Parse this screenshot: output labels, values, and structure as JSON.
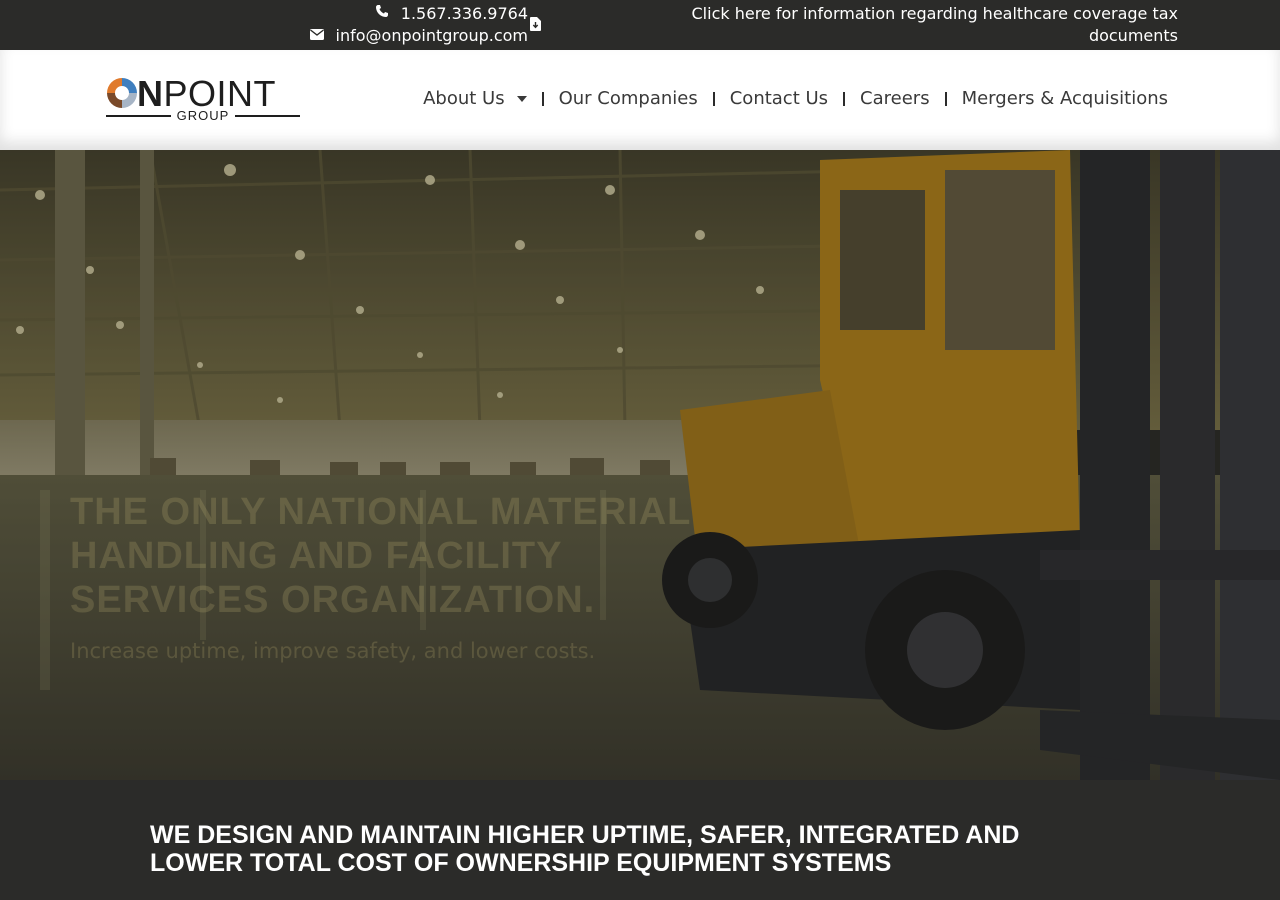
{
  "topbar": {
    "phone": "1.567.336.9764",
    "email": "info@onpointgroup.com",
    "phone_icon": "phone-icon",
    "email_icon": "envelope-icon",
    "document_icon": "file-download-icon",
    "notice": "Click here for information regarding healthcare coverage tax documents"
  },
  "logo": {
    "word_bold": "N",
    "word_light": "POINT",
    "sub": "GROUP",
    "colors": [
      "#e07a2c",
      "#3f7fbf",
      "#a7b5c6",
      "#7a4a2a"
    ]
  },
  "nav": {
    "items": [
      {
        "label": "About Us",
        "has_dropdown": true
      },
      {
        "label": "Our Companies"
      },
      {
        "label": "Contact Us"
      },
      {
        "label": "Careers"
      },
      {
        "label": "Mergers & Acquisitions"
      }
    ]
  },
  "hero": {
    "title": "The only national material handling and facility services organization.",
    "subtitle": "Increase uptime, improve safety, and lower costs."
  },
  "bottom": {
    "title": "We design and maintain higher uptime, safer, integrated and lower total cost of ownership equipment systems"
  },
  "colors": {
    "dark_bar": "#2b2b29",
    "header_bg": "#ffffff",
    "nav_text": "#3a3a3a",
    "forklift_yellow": "#c8901a"
  }
}
